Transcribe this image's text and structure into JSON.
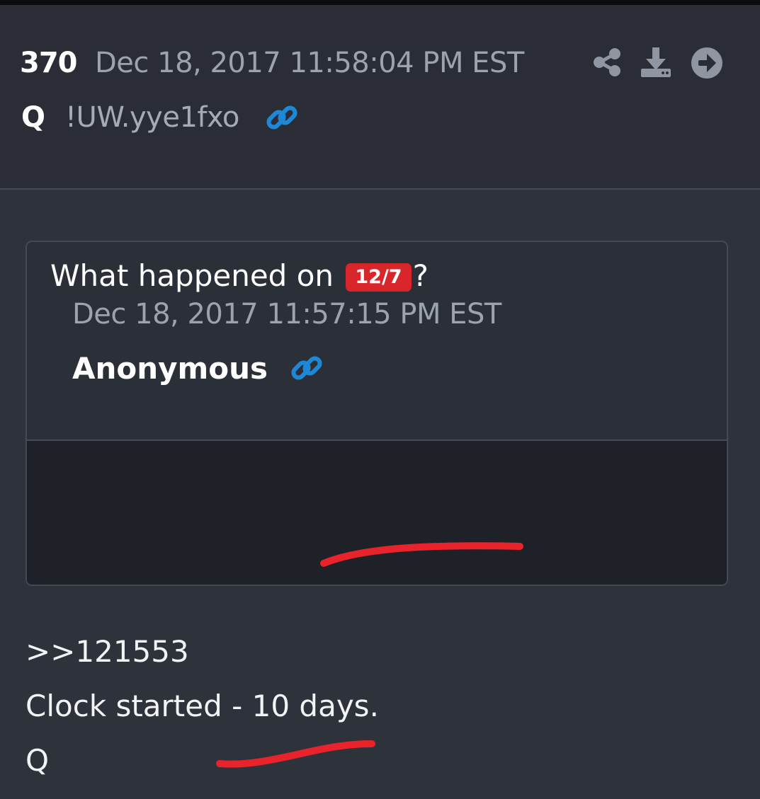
{
  "post": {
    "number": "370",
    "datetime": "Dec 18, 2017 11:58:04 PM EST",
    "author": "Q",
    "tripcode": "!UW.yye1fxo"
  },
  "quoted_post": {
    "datetime": "Dec 18, 2017 11:57:15 PM EST",
    "author": "Anonymous",
    "text_before": "What happened on",
    "date_badge": "12/7",
    "text_after": "?"
  },
  "reply": {
    "reference": ">>121553",
    "line": "Clock started - 10 days.",
    "signature": "Q"
  },
  "colors": {
    "background": "#2e323b",
    "header_background": "#2a2d35",
    "link_icon": "#1e88d6",
    "badge": "#d8262b",
    "annotation_underline": "#e8232b"
  },
  "icons": {
    "share": "share-icon",
    "download": "download-icon",
    "goto": "arrow-right-circle-icon",
    "link": "link-icon"
  }
}
